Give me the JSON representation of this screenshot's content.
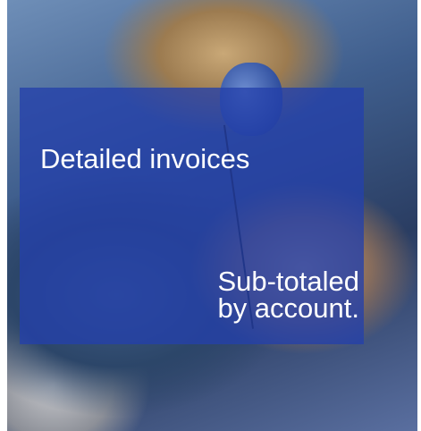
{
  "slide": {
    "headline": "Detailed invoices",
    "subline": {
      "line1": "Sub-totaled",
      "line2": "by account."
    },
    "overlay_color": "#2440aa",
    "text_color": "#ffffff"
  }
}
